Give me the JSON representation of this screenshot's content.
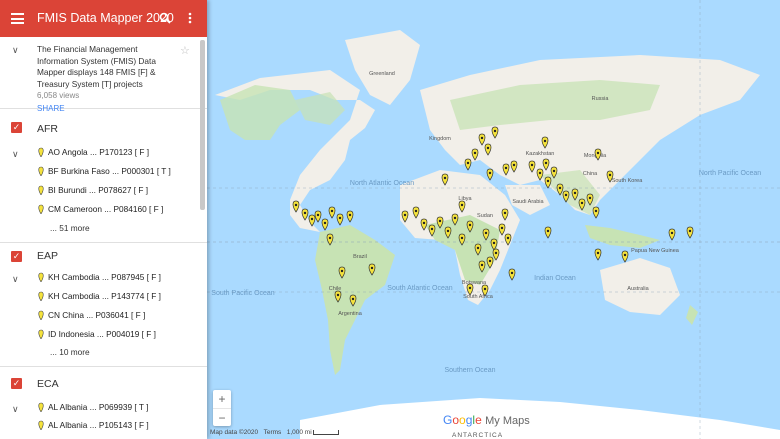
{
  "app": {
    "title": "FMIS Data Mapper 2020"
  },
  "description": {
    "text": "The Financial Management Information System (FMIS) Data Mapper displays 148 FMIS [F] & Treasury System [T] projects",
    "views": "6,058 views",
    "share": "SHARE"
  },
  "layers": [
    {
      "name": "AFR",
      "items": [
        "AO Angola ... P170123 [ F ]",
        "BF Burkina Faso ... P000301 [ T ]",
        "BI Burundi ... P078627 [ F ]",
        "CM Cameroon ... P084160 [ F ]"
      ],
      "more": "... 51 more"
    },
    {
      "name": "EAP",
      "items": [
        "KH Cambodia ... P087945 [ F ]",
        "KH Cambodia ... P143774 [ F ]",
        "CN China ... P036041 [ F ]",
        "ID Indonesia ... P004019 [ F ]"
      ],
      "more": "... 10 more"
    },
    {
      "name": "ECA",
      "items": [
        "AL Albania ... P069939 [ T ]",
        "AL Albania ... P105143 [ F ]"
      ]
    }
  ],
  "map": {
    "labels": {
      "greenland": "Greenland",
      "north_atlantic": "North Atlantic Ocean",
      "south_atlantic": "South Atlantic Ocean",
      "north_pacific": "North Pacific Ocean",
      "south_pacific": "South Pacific Ocean",
      "indian": "Indian Ocean",
      "southern": "Southern Ocean",
      "brazil": "Brazil",
      "australia": "Australia",
      "kazakhstan": "Kazakhstan",
      "russia": "Russia",
      "china": "China",
      "libya": "Libya",
      "sudan": "Sudan",
      "saudi": "Saudi Arabia",
      "mongolia": "Mongolia",
      "south_korea": "South Korea",
      "papua": "Papua New Guinea",
      "south_africa": "South Africa",
      "botswana": "Botswana",
      "argentina": "Argentina",
      "chile": "Chile",
      "kingdom": "Kingdom",
      "antarctica": "ANTARCTICA"
    },
    "footer": {
      "data": "Map data ©2020",
      "terms": "Terms",
      "scale": "1,000 mi"
    },
    "logo": {
      "google": "Google",
      "mymaps": "My Maps"
    },
    "colors": {
      "water": "#aadaff",
      "land": "#f2efe9",
      "green": "#c7e3b4",
      "pin": "#f5e33d",
      "header": "#db4437"
    }
  }
}
